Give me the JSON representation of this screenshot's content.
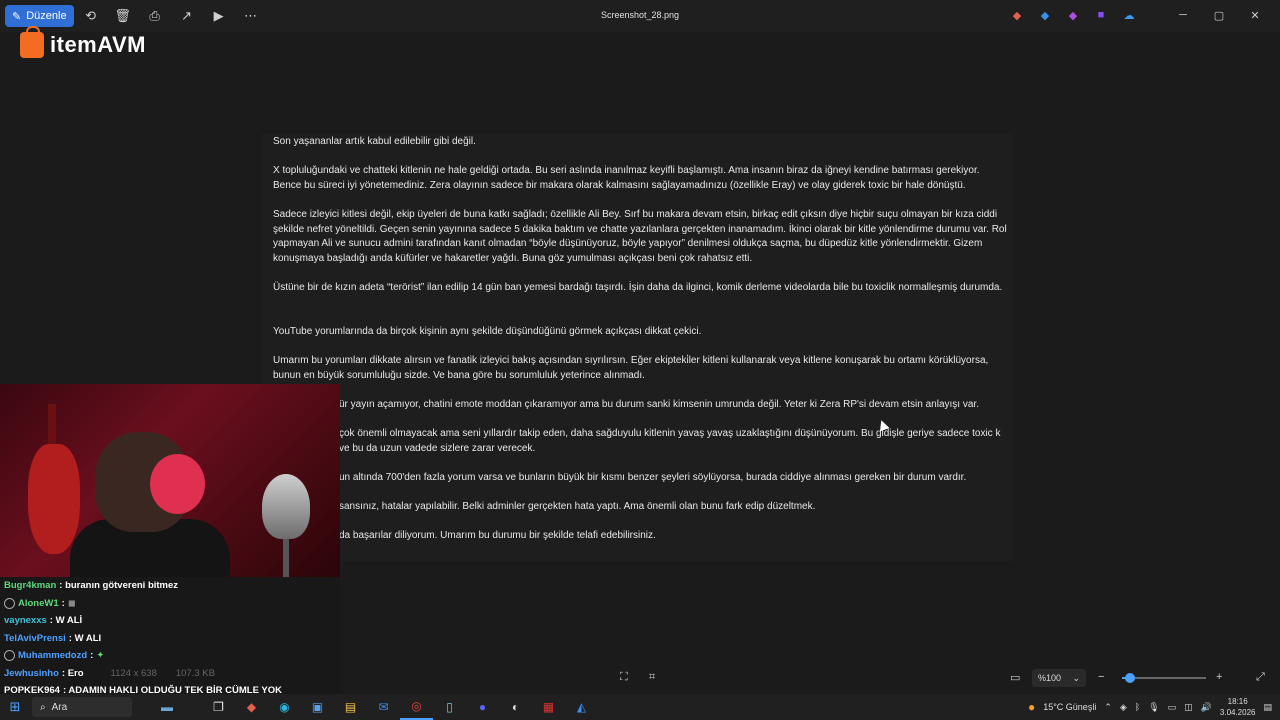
{
  "titlebar": {
    "edit_label": "Düzenle",
    "file_name": "Screenshot_28.png"
  },
  "logo": {
    "text_left": "item",
    "text_right": "AVM"
  },
  "document": {
    "paragraphs": [
      "Son yaşananlar artık kabul edilebilir gibi değil.",
      "X topluluğundaki ve chatteki kitlenin ne hale geldiği ortada. Bu seri aslında inanılmaz keyifli başlamıştı. Ama insanın biraz da iğneyi kendine batırması gerekiyor. Bence bu süreci iyi yönetemediniz. Zera olayının sadece bir makara olarak kalmasını sağlayamadınızu (özellikle Eray) ve olay giderek toxic bir hale dönüştü.",
      "Sadece izleyici kitlesi değil, ekip üyeleri de buna katkı sağladı; özellikle Ali Bey. Sırf bu makara devam etsin, birkaç edit çıksın diye hiçbir suçu olmayan bir kıza ciddi şekilde nefret yöneltildi. Geçen senin yayınına sadece 5 dakika baktım ve chatte yazılanlara gerçekten inanamadım. İkinci olarak bir kitle yönlendirme durumu var. Rol yapmayan Ali ve sunucu admini tarafından kanıt olmadan “böyle düşünüyoruz, böyle yapıyor” denilmesi oldukça saçma, bu düpedüz kitle yönlendirmektir. Gizem konuşmaya başladığı anda küfürler ve hakaretler yağdı. Buna göz yumulması açıkçası beni çok rahatsız etti.",
      "Üstüne bir de kızın adeta “terörist” ilan edilip 14 gün ban yemesi bardağı taşırdı. İşin daha da ilginci, komik derleme videolarda bile bu toxiclik normalleşmiş durumda.",
      "YouTube yorumlarında da birçok kişinin aynı şekilde düşündüğünü görmek açıkçası dikkat çekici.",
      "Umarım bu yorumları dikkate alırsın ve fanatik izleyici bakış açısından sıyrılırsın. Eğer ekipteki̇ler kitleni kullanarak veya kitlene konuşarak bu ortamı körüklüyorsa, bunun en büyük sorumluluğu sizde. Ve bana göre bu sorumluluk yeterince alınmadı.",
      "ür yayın açamıyor, chatini emote moddan çıkaramıyor ama bu durum sanki kimsenin umrunda değil. Yeter ki Zera RP'si devam etsin anlayışı var.",
      "çok önemli olmayacak ama seni yıllardır takip eden, daha sağduyulu kitlenin yavaş yavaş uzaklaştığını düşünüyorum. Bu gidişle geriye sadece toxic k ve bu da uzun vadede sizlere zarar verecek.",
      "un altında 700'den fazla yorum varsa ve bunların büyük bir kısmı benzer şeyleri söylüyorsa, burada ciddiye alınması gereken bir durum vardır.",
      "sansınız, hatalar yapılabilir. Belki adminler gerçekten hata yaptı. Ama önemli olan bunu fark edip düzeltmek.",
      "da başarılar diliyorum. Umarım bu durumu bir şekilde telafi edebilirsiniz."
    ]
  },
  "chat": {
    "messages": [
      {
        "user": "Bugr4kman",
        "text": ": buranın götvereni bitmez",
        "color": "#5cd97a"
      },
      {
        "user": "AloneW1",
        "text": ":",
        "color": "#5cd97a"
      },
      {
        "user": "vaynexxs",
        "text": ": W ALİ",
        "color": "#3fc2d8"
      },
      {
        "user": "TelAvivPrensi",
        "text": ": W ALI",
        "color": "#4fa0ff"
      },
      {
        "user": "Muhammedozd",
        "text": ":",
        "color": "#4fa0ff"
      },
      {
        "user": "Jewhusinho",
        "text": ": Ero",
        "color": "#4fa0ff"
      },
      {
        "user": "POPKEK964",
        "text": ": ADAMIN HAKLI OLDUĞU TEK BİR CÜMLE YOK",
        "color": "#ffffff"
      }
    ]
  },
  "image_meta": {
    "dimensions": "1124 x 638",
    "size": "107.3 KB"
  },
  "viewer": {
    "zoom_label": "%100",
    "zoom_level": 0.1
  },
  "taskbar": {
    "search_label": "Ara",
    "weather": "15°C  Güneşli",
    "time": "18:16",
    "date": "3.04.2026"
  }
}
